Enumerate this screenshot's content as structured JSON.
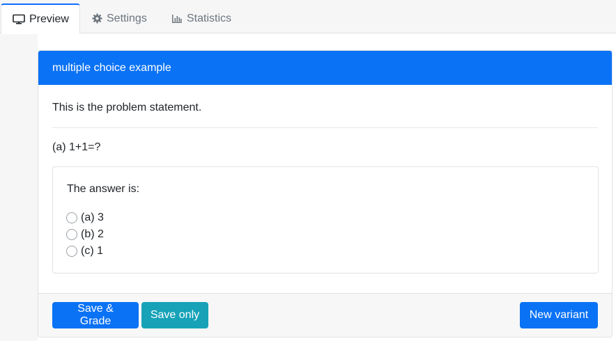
{
  "tabs": [
    {
      "label": "Preview",
      "icon": "monitor-icon",
      "active": true
    },
    {
      "label": "Settings",
      "icon": "gear-icon",
      "active": false
    },
    {
      "label": "Statistics",
      "icon": "bar-chart-icon",
      "active": false
    }
  ],
  "card": {
    "title": "multiple choice example",
    "statement": "This is the problem statement.",
    "question": "(a) 1+1=?",
    "answer_prompt": "The answer is:",
    "options": [
      {
        "label": "(a) 3",
        "selected": false
      },
      {
        "label": "(b) 2",
        "selected": false
      },
      {
        "label": "(c) 1",
        "selected": false
      }
    ]
  },
  "buttons": {
    "save_grade": "Save & Grade",
    "save_only": "Save only",
    "new_variant": "New variant"
  },
  "colors": {
    "primary": "#0a72f5",
    "info": "#17a2b8",
    "tab_bar": "#f6f6f7"
  }
}
